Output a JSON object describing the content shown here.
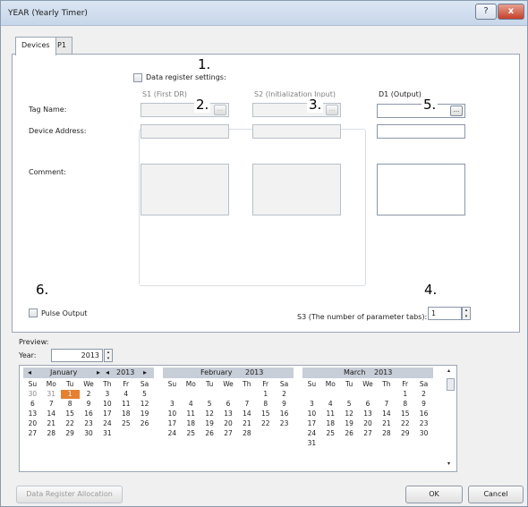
{
  "window": {
    "title": "YEAR (Yearly Timer)",
    "help_glyph": "?",
    "close_glyph": "x"
  },
  "tabs": [
    "Devices",
    "P1"
  ],
  "devices": {
    "data_register_label": "Data register settings:",
    "s1_label": "S1 (First DR)",
    "s2_label": "S2 (Initialization Input)",
    "d1_label": "D1 (Output)",
    "row_labels": [
      "Tag Name:",
      "Device Address:",
      "Comment:"
    ],
    "browse_label": "...",
    "pulse_output_label": "Pulse Output",
    "s3_label": "S3 (The number of parameter tabs):",
    "s3_value": "1"
  },
  "callouts": [
    "1.",
    "2.",
    "3.",
    "4.",
    "5.",
    "6."
  ],
  "preview": {
    "label": "Preview:",
    "year_label": "Year:",
    "year_value": "2013",
    "weekdays": [
      "Su",
      "Mo",
      "Tu",
      "We",
      "Th",
      "Fr",
      "Sa"
    ],
    "nav_prev": "◂",
    "nav_next": "▸",
    "months": [
      {
        "name": "January",
        "year": "2013",
        "days": [
          "30",
          "31",
          "1",
          "2",
          "3",
          "4",
          "5",
          "6",
          "7",
          "8",
          "9",
          "10",
          "11",
          "12",
          "13",
          "14",
          "15",
          "16",
          "17",
          "18",
          "19",
          "20",
          "21",
          "22",
          "23",
          "24",
          "25",
          "26",
          "27",
          "28",
          "29",
          "30",
          "31"
        ]
      },
      {
        "name": "February",
        "year": "2013",
        "days": [
          "",
          "",
          "",
          "",
          "",
          "1",
          "2",
          "3",
          "4",
          "5",
          "6",
          "7",
          "8",
          "9",
          "10",
          "11",
          "12",
          "13",
          "14",
          "15",
          "16",
          "17",
          "18",
          "19",
          "20",
          "21",
          "22",
          "23",
          "24",
          "25",
          "26",
          "27",
          "28"
        ]
      },
      {
        "name": "March",
        "year": "2013",
        "days": [
          "",
          "",
          "",
          "",
          "",
          "1",
          "2",
          "3",
          "4",
          "5",
          "6",
          "7",
          "8",
          "9",
          "10",
          "11",
          "12",
          "13",
          "14",
          "15",
          "16",
          "17",
          "18",
          "19",
          "20",
          "21",
          "22",
          "23",
          "24",
          "25",
          "26",
          "27",
          "28",
          "29",
          "30",
          "31"
        ]
      }
    ],
    "highlight_color": "#e58030"
  },
  "buttons": {
    "allocation": "Data Register Allocation",
    "ok": "OK",
    "cancel": "Cancel"
  }
}
